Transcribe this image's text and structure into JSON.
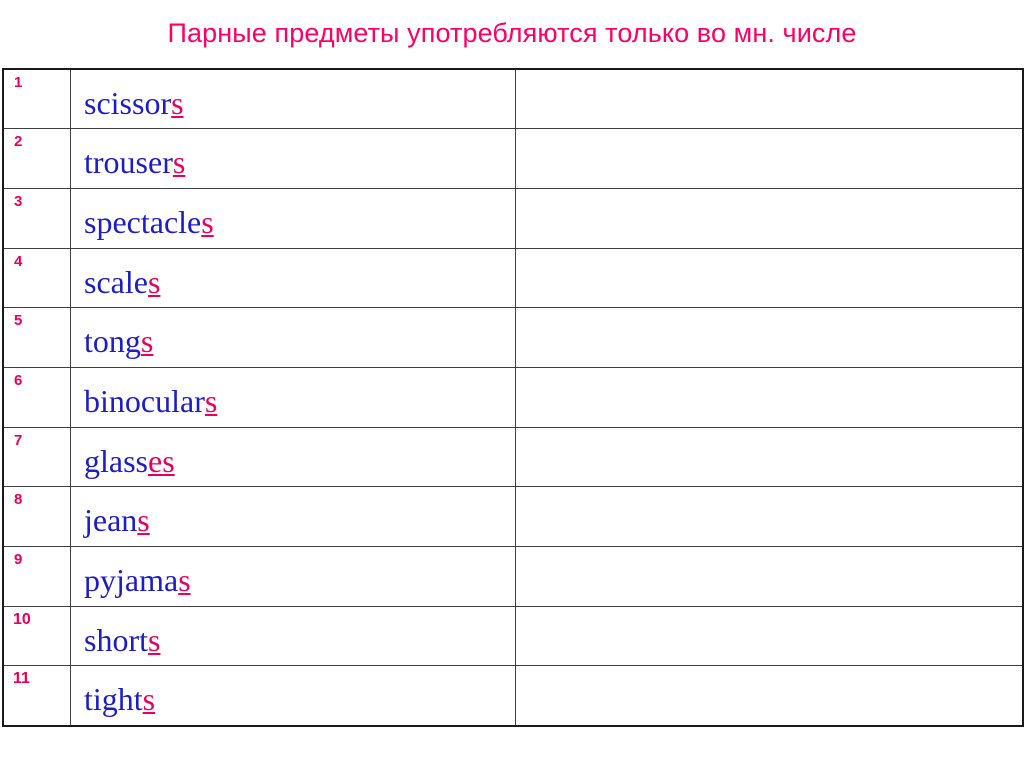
{
  "slide": {
    "title": "Парные предметы употребляются только во мн. числе",
    "background_color": "#FFFFFF",
    "title_color": "#FF0066",
    "word_color": "#1C1CC8",
    "suffix_color": "#E8005C",
    "number_color": "#E8005C",
    "border_color": "#3F3F3F"
  },
  "table": {
    "column_count": 3,
    "row_count": 11,
    "rows": [
      {
        "number": "1",
        "stem": "scissor",
        "suffix": "s",
        "answer": ""
      },
      {
        "number": "2",
        "stem": "trouser",
        "suffix": "s",
        "answer": ""
      },
      {
        "number": "3",
        "stem": "spectacle",
        "suffix": "s",
        "answer": ""
      },
      {
        "number": "4",
        "stem": "scale",
        "suffix": "s",
        "answer": ""
      },
      {
        "number": "5",
        "stem": "tong",
        "suffix": "s",
        "answer": ""
      },
      {
        "number": "6",
        "stem": "binocular",
        "suffix": "s",
        "answer": ""
      },
      {
        "number": "7",
        "stem": "glass",
        "suffix": "es",
        "answer": ""
      },
      {
        "number": "8",
        "stem": "jean",
        "suffix": "s",
        "answer": ""
      },
      {
        "number": "9",
        "stem": "pyjama",
        "suffix": "s",
        "answer": ""
      },
      {
        "number": "10",
        "stem": "short",
        "suffix": "s",
        "answer": ""
      },
      {
        "number": "11",
        "stem": "tight",
        "suffix": "s",
        "answer": ""
      }
    ]
  }
}
